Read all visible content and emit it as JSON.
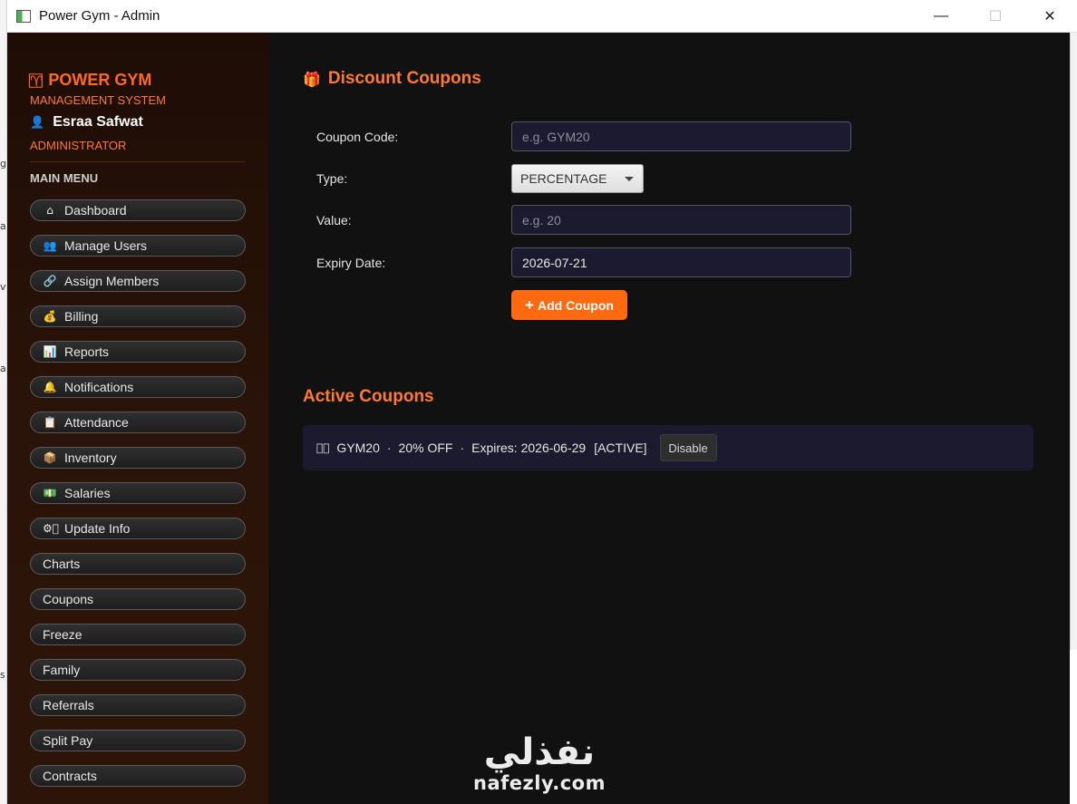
{
  "window": {
    "title": "Power Gym - Admin",
    "minimize_glyph": "—",
    "maximize_glyph": "☐",
    "close_glyph": "✕"
  },
  "desktop": {
    "edge_chars": [
      "g",
      "a",
      "v",
      "a",
      "s"
    ]
  },
  "sidebar": {
    "brand_icon": "♈⃞",
    "brand": "POWER GYM",
    "subtitle": "MANAGEMENT SYSTEM",
    "user_icon": "👤",
    "user_name": "Esraa Safwat",
    "role": "ADMINISTRATOR",
    "menu_heading": "MAIN MENU",
    "items": [
      {
        "icon": "⌂",
        "label": "Dashboard"
      },
      {
        "icon": "👥",
        "label": "Manage Users"
      },
      {
        "icon": "🔗",
        "label": "Assign Members"
      },
      {
        "icon": "💰",
        "label": "Billing"
      },
      {
        "icon": "📊",
        "label": "Reports"
      },
      {
        "icon": "🔔",
        "label": "Notifications"
      },
      {
        "icon": "📋",
        "label": "Attendance"
      },
      {
        "icon": "📦",
        "label": "Inventory"
      },
      {
        "icon": "💵",
        "label": "Salaries"
      },
      {
        "icon": "⚙⃞",
        "label": "Update Info"
      },
      {
        "icon": "",
        "label": "Charts"
      },
      {
        "icon": "",
        "label": "Coupons"
      },
      {
        "icon": "",
        "label": "Freeze"
      },
      {
        "icon": "",
        "label": "Family"
      },
      {
        "icon": "",
        "label": "Referrals"
      },
      {
        "icon": "",
        "label": "Split Pay"
      },
      {
        "icon": "",
        "label": "Contracts"
      }
    ]
  },
  "main": {
    "title_icon": "🎁",
    "title": "Discount Coupons",
    "form": {
      "code_label": "Coupon Code:",
      "code_placeholder": "e.g. GYM20",
      "type_label": "Type:",
      "type_value": "PERCENTAGE",
      "value_label": "Value:",
      "value_placeholder": "e.g. 20",
      "expiry_label": "Expiry Date:",
      "expiry_value": "2026-07-21",
      "add_plus": "+",
      "add_label": "Add Coupon"
    },
    "active_title": "Active Coupons",
    "coupons": [
      {
        "icon": "🏷⃞",
        "code": "GYM20",
        "discount": "20% OFF",
        "expires": "Expires: 2026-06-29",
        "status": "[ACTIVE]",
        "action": "Disable"
      }
    ]
  },
  "watermark": {
    "arabic": "نفذلي",
    "latin": "nafezly.com"
  }
}
